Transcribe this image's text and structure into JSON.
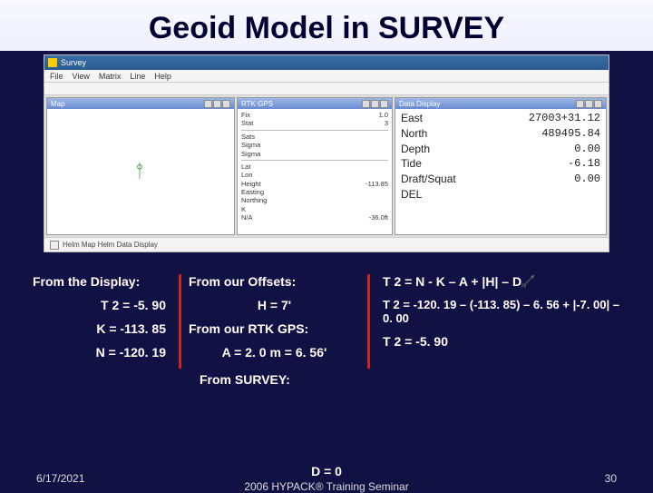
{
  "slide": {
    "title": "Geoid Model in SURVEY",
    "date": "6/17/2021",
    "seminar": "2006 HYPACK® Training Seminar",
    "page": "30"
  },
  "survey_app": {
    "window_title": "Survey",
    "menubar": [
      "File",
      "View",
      "Matrix",
      "Line",
      "Help"
    ],
    "map_panel": {
      "title": "Map"
    },
    "rtk_panel": {
      "title": "RTK GPS",
      "rows": [
        {
          "label": "Fix",
          "value": "1.0"
        },
        {
          "label": "Stat",
          "value": "3"
        },
        {
          "label": "Sats",
          "value": ""
        },
        {
          "label": "Sigma",
          "value": ""
        },
        {
          "label": "Sigma",
          "value": ""
        },
        {
          "label": "Lat",
          "value": ""
        },
        {
          "label": "Lon",
          "value": ""
        },
        {
          "label": "Height",
          "value": "-113.85"
        },
        {
          "label": "Easting",
          "value": ""
        },
        {
          "label": "Northing",
          "value": ""
        },
        {
          "label": "K",
          "value": ""
        },
        {
          "label": "N/A",
          "value": "-36.0ft"
        }
      ]
    },
    "data_display": {
      "title": "Data Display",
      "rows": [
        {
          "label": "East",
          "value": "27003+31.12"
        },
        {
          "label": "North",
          "value": "489495.84"
        },
        {
          "label": "Depth",
          "value": "0.00"
        },
        {
          "label": "Tide",
          "value": "-6.18"
        },
        {
          "label": "Draft/Squat",
          "value": "0.00"
        },
        {
          "label": "DEL",
          "value": ""
        }
      ]
    },
    "helm_label": "Helm Map    Helm Data Display"
  },
  "calc": {
    "col1_header": "From the Display:",
    "col1_lines": [
      "T 2 = -5. 90",
      "K = -113. 85",
      "N = -120. 19"
    ],
    "col2_header": "From our Offsets:",
    "col2_lines": [
      "H = 7'",
      "From our RTK GPS:",
      "A = 2. 0 m = 6. 56'"
    ],
    "col3_header": "T 2 = N - K – A + |H| – D",
    "col3_lines": [
      "T 2 = -120. 19 – (-113. 85) – 6. 56 + |-7. 00| – 0. 00",
      "T 2 = -5. 90"
    ],
    "survey_header": "From SURVEY:",
    "survey_line": "D = 0"
  }
}
